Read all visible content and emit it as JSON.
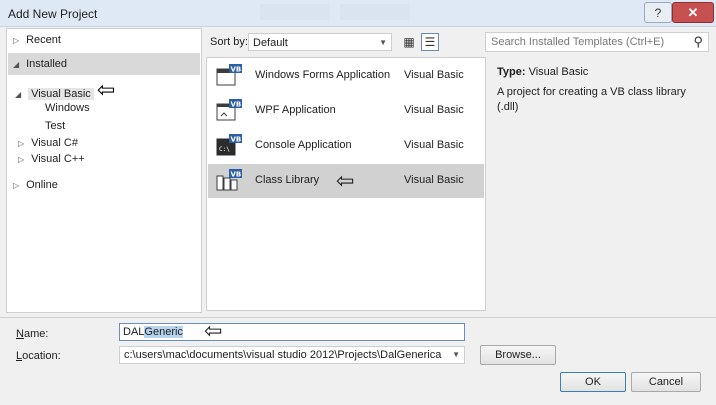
{
  "window": {
    "title": "Add New Project",
    "help_glyph": "?",
    "close_glyph": "✕"
  },
  "tree": {
    "recent": "Recent",
    "installed": "Installed",
    "visual_basic": "Visual Basic",
    "windows": "Windows",
    "test": "Test",
    "visual_csharp": "Visual C#",
    "visual_cpp": "Visual C++",
    "online": "Online"
  },
  "toolbar": {
    "sort_label": "Sort by:",
    "sort_value": "Default",
    "search_placeholder": "Search Installed Templates (Ctrl+E)"
  },
  "templates": [
    {
      "name": "Windows Forms Application",
      "language": "Visual Basic",
      "icon": "windows-forms-icon"
    },
    {
      "name": "WPF Application",
      "language": "Visual Basic",
      "icon": "wpf-icon"
    },
    {
      "name": "Console Application",
      "language": "Visual Basic",
      "icon": "console-icon"
    },
    {
      "name": "Class Library",
      "language": "Visual Basic",
      "icon": "class-library-icon"
    }
  ],
  "details": {
    "type_label": "Type:",
    "type_value": "Visual Basic",
    "description": "A project for creating a VB class library (.dll)"
  },
  "form": {
    "name_label": "Name:",
    "name_prefix": "DAL",
    "name_selected": "Generic",
    "location_label": "Location:",
    "location_value": "c:\\users\\mac\\documents\\visual studio 2012\\Projects\\DalGenerica",
    "browse_label": "Browse...",
    "ok_label": "OK",
    "cancel_label": "Cancel"
  },
  "annotations": {
    "arrow_glyph": "⇦"
  },
  "colors": {
    "selected_row": "#d1d1d1",
    "name_highlight": "#b7d4ef",
    "close_button": "#c75050"
  }
}
